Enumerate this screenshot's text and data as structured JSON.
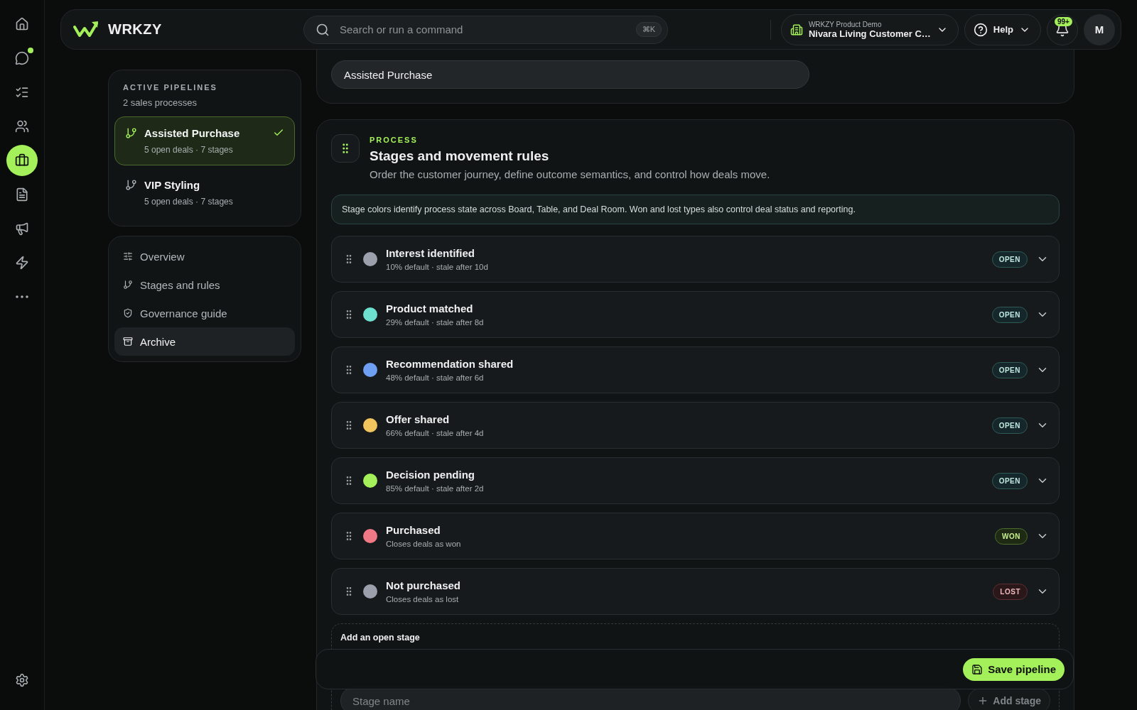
{
  "rail": {
    "items": [
      {
        "selected": false,
        "dot": false
      },
      {
        "selected": false,
        "dot": true
      },
      {
        "selected": false,
        "dot": false
      },
      {
        "selected": false,
        "dot": false
      },
      {
        "selected": true,
        "dot": false
      },
      {
        "selected": false,
        "dot": false
      },
      {
        "selected": false,
        "dot": false
      },
      {
        "selected": false,
        "dot": false
      },
      {
        "selected": false,
        "dot": false
      }
    ],
    "bottom": {
      "selected": false
    }
  },
  "header": {
    "brand": "WRKZY",
    "search": {
      "placeholder": "Search or run a command",
      "shortcut": "⌘K"
    },
    "workspace": {
      "label": "WRKZY Product Demo",
      "name": "Nivara Living Customer C…"
    },
    "help": "Help",
    "notifications": "99+",
    "avatar": "M"
  },
  "pipelines": {
    "heading": "ACTIVE PIPELINES",
    "subheading": "2 sales processes",
    "items": [
      {
        "name": "Assisted Purchase",
        "meta": "5 open deals · 7 stages",
        "selected": true
      },
      {
        "name": "VIP Styling",
        "meta": "5 open deals · 7 stages",
        "selected": false
      }
    ]
  },
  "nav": [
    {
      "label": "Overview",
      "selected": false
    },
    {
      "label": "Stages and rules",
      "selected": false
    },
    {
      "label": "Governance guide",
      "selected": false
    },
    {
      "label": "Archive",
      "selected": true
    }
  ],
  "pipeline_name": {
    "value": "Assisted Purchase"
  },
  "process": {
    "eyebrow": "PROCESS",
    "title": "Stages and movement rules",
    "subtitle": "Order the customer journey, define outcome semantics, and control how deals move.",
    "notice": "Stage colors identify process state across Board, Table, and Deal Room. Won and lost types also control deal status and reporting.",
    "stages": [
      {
        "name": "Interest identified",
        "meta": "10% default · stale after 10d",
        "color": "#9ca0ad",
        "kind": "open",
        "badge": "OPEN"
      },
      {
        "name": "Product matched",
        "meta": "29% default · stale after 8d",
        "color": "#6ee0cf",
        "kind": "open",
        "badge": "OPEN"
      },
      {
        "name": "Recommendation shared",
        "meta": "48% default · stale after 6d",
        "color": "#6f9ff2",
        "kind": "open",
        "badge": "OPEN"
      },
      {
        "name": "Offer shared",
        "meta": "66% default · stale after 4d",
        "color": "#f2c45e",
        "kind": "open",
        "badge": "OPEN"
      },
      {
        "name": "Decision pending",
        "meta": "85% default · stale after 2d",
        "color": "#a3f05a",
        "kind": "open",
        "badge": "OPEN"
      },
      {
        "name": "Purchased",
        "meta": "Closes deals as won",
        "color": "#ef7a86",
        "kind": "won",
        "badge": "WON"
      },
      {
        "name": "Not purchased",
        "meta": "Closes deals as lost",
        "color": "#9ca0ad",
        "kind": "lost",
        "badge": "LOST"
      }
    ],
    "add": {
      "title": "Add an open stage",
      "placeholder": "Stage name",
      "button": "Add stage"
    }
  },
  "save": {
    "label": "Save pipeline"
  }
}
